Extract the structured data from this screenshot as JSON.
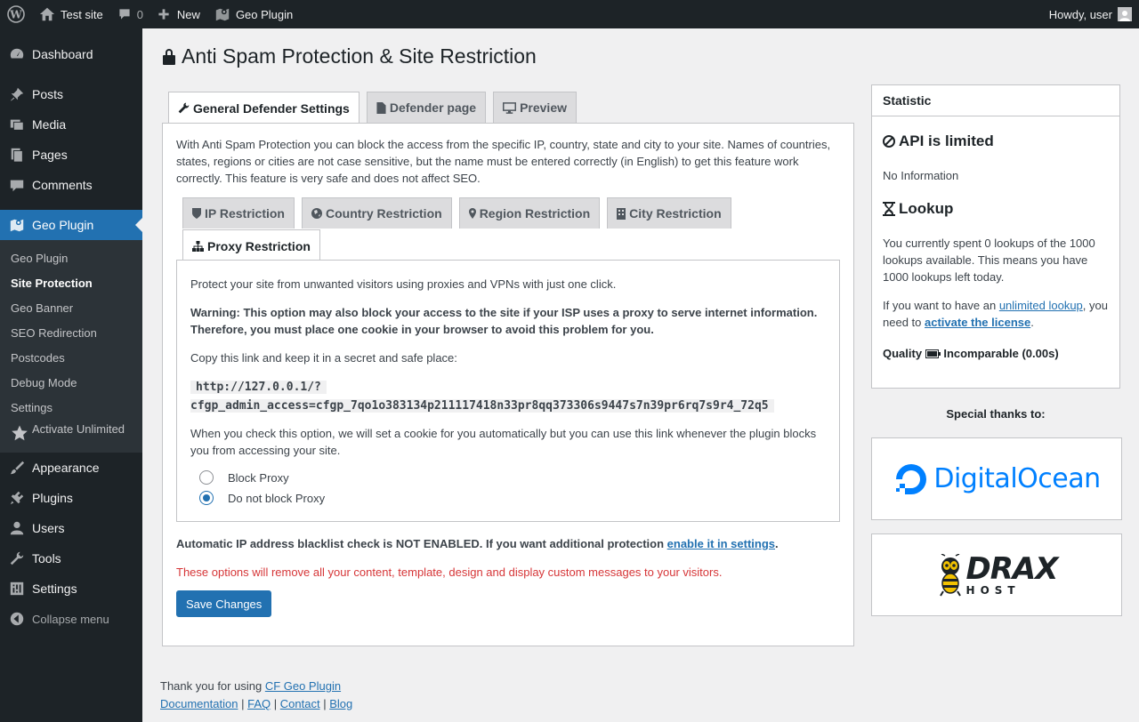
{
  "adminbar": {
    "site_name": "Test site",
    "comments_count": "0",
    "new_label": "New",
    "plugin_label": "Geo Plugin",
    "howdy": "Howdy, user"
  },
  "sidebar": {
    "dashboard": "Dashboard",
    "posts": "Posts",
    "media": "Media",
    "pages": "Pages",
    "comments": "Comments",
    "geo_plugin": "Geo Plugin",
    "submenu": [
      "Geo Plugin",
      "Site Protection",
      "Geo Banner",
      "SEO Redirection",
      "Postcodes",
      "Debug Mode",
      "Settings",
      "Activate Unlimited"
    ],
    "appearance": "Appearance",
    "plugins": "Plugins",
    "users": "Users",
    "tools": "Tools",
    "settings": "Settings",
    "collapse": "Collapse menu"
  },
  "page": {
    "title": "Anti Spam Protection & Site Restriction",
    "tabs": [
      "General Defender Settings",
      "Defender page",
      "Preview"
    ],
    "intro": "With Anti Spam Protection you can block the access from the specific IP, country, state and city to your site. Names of countries, states, regions or cities are not case sensitive, but the name must be entered correctly (in English) to get this feature work correctly. This feature is very safe and does not affect SEO.",
    "subtabs": [
      "IP Restriction",
      "Country Restriction",
      "Region Restriction",
      "City Restriction",
      "Proxy Restriction"
    ],
    "proxy": {
      "p1": "Protect your site from unwanted visitors using proxies and VPNs with just one click.",
      "warning": "Warning: This option may also block your access to the site if your ISP uses a proxy to serve internet information. Therefore, you must place one cookie in your browser to avoid this problem for you.",
      "copy_text": "Copy this link and keep it in a secret and safe place:",
      "link_line1": "http://127.0.0.1/?",
      "link_line2": "cfgp_admin_access=cfgp_7qo1o383134p211117418n33pr8qq373306s9447s7n39pr6rq7s9r4_72q5",
      "cookie_text": "When you check this option, we will set a cookie for you automatically but you can use this link whenever the plugin blocks you from accessing your site.",
      "radio_block": "Block Proxy",
      "radio_noblock": "Do not block Proxy"
    },
    "blacklist_text": "Automatic IP address blacklist check is NOT ENABLED. If you want additional protection",
    "blacklist_link": "enable it in settings",
    "blacklist_end": ".",
    "red_notice": "These options will remove all your content, template, design and display custom messages to your visitors.",
    "save_button": "Save Changes",
    "footer_thanks": "Thank you for using",
    "footer_plugin_link": "CF Geo Plugin",
    "footer_links": [
      "Documentation",
      "FAQ",
      "Contact",
      "Blog"
    ],
    "footer_sep": "|"
  },
  "statistic": {
    "title": "Statistic",
    "api_heading": "API is limited",
    "no_info": "No Information",
    "lookup_heading": "Lookup",
    "lookup_text": "You currently spent 0 lookups of the 1000 lookups available. This means you have 1000 lookups left today.",
    "unlimited_pre": "If you want to have an",
    "unlimited_link": "unlimited lookup",
    "unlimited_mid": ", you need to",
    "activate_link": "activate the license",
    "unlimited_end": ".",
    "quality_label": "Quality",
    "quality_value": "Incomparable (0.00s)",
    "thanks": "Special thanks to:",
    "sponsor1": "DigitalOcean",
    "sponsor2_top": "DRAX",
    "sponsor2_bottom": "HOST"
  },
  "colors": {
    "accent": "#2271b1",
    "red": "#d63638",
    "digitalocean": "#0080ff"
  }
}
